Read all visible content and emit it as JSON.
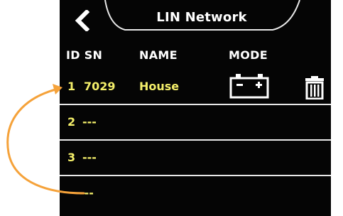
{
  "header": {
    "title": "LIN Network",
    "back_icon": "chevron-left-icon"
  },
  "columns": {
    "id_sn": "ID SN",
    "name": "NAME",
    "mode": "MODE"
  },
  "rows": [
    {
      "id": "1",
      "sn": "7029",
      "name": "House",
      "mode_icon": "battery-icon",
      "action_icon": "trash-icon"
    },
    {
      "id": "2",
      "sn": "---"
    },
    {
      "id": "3",
      "sn": "---"
    },
    {
      "id": "",
      "sn": "---"
    }
  ],
  "colors": {
    "screen_bg": "#050505",
    "header_text": "#ffffff",
    "row_text": "#f4ef6a",
    "divider": "#e8e8e8",
    "annotation_arrow": "#f5a23a"
  }
}
